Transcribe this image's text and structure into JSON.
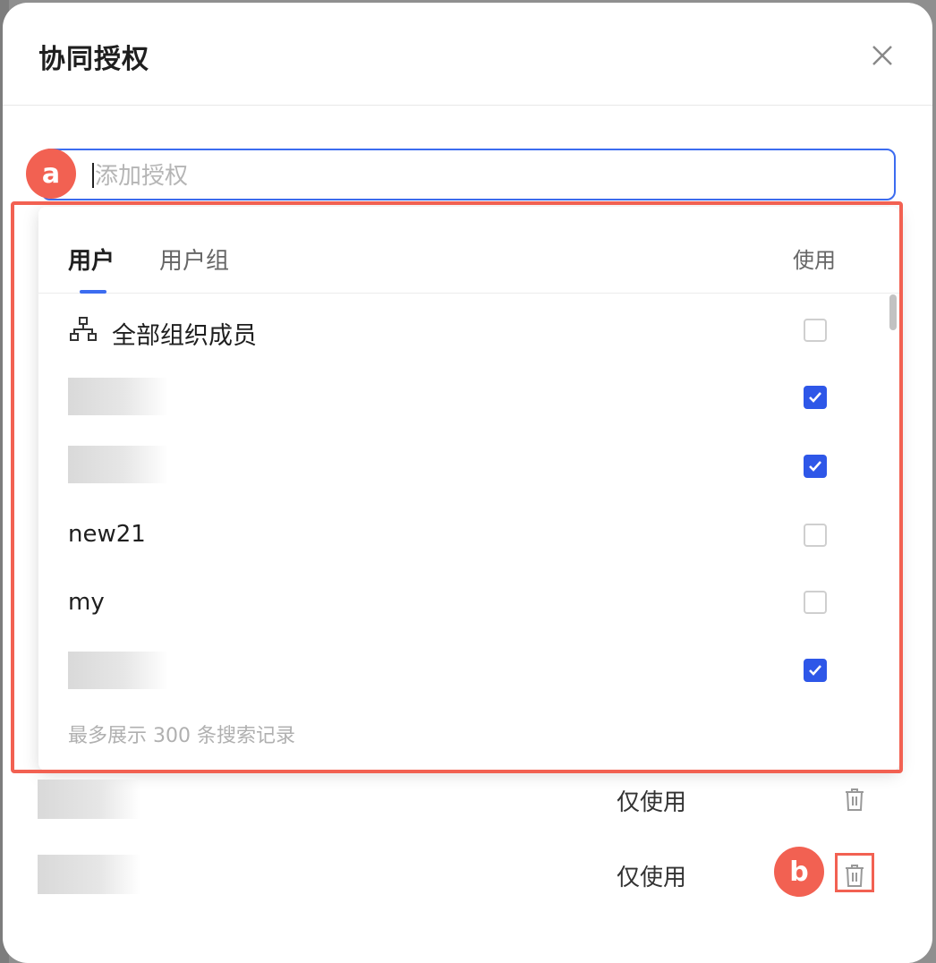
{
  "dialog": {
    "title": "协同授权"
  },
  "search": {
    "placeholder": "添加授权"
  },
  "dropdown": {
    "tabs": [
      {
        "label": "用户",
        "active": true
      },
      {
        "label": "用户组",
        "active": false
      }
    ],
    "use_column_label": "使用",
    "rows": [
      {
        "label": "全部组织成员",
        "icon": "org-chart-icon",
        "checked": false
      },
      {
        "label": "",
        "redacted": true,
        "checked": true
      },
      {
        "label": "",
        "redacted": true,
        "checked": true
      },
      {
        "label": "new21",
        "checked": false
      },
      {
        "label": "my",
        "checked": false
      },
      {
        "label": "",
        "redacted": true,
        "checked": true
      }
    ],
    "footer_note": "最多展示 300 条搜索记录"
  },
  "permissions": [
    {
      "user": "",
      "redacted": true,
      "role": "仅使用",
      "action_icon": "trash-icon"
    },
    {
      "user": "",
      "redacted": true,
      "role": "仅使用",
      "action_icon": "trash-icon"
    }
  ],
  "annotations": {
    "a": "a",
    "b": "b"
  },
  "colors": {
    "accent": "#2e57e8",
    "annotation": "#f26152"
  }
}
